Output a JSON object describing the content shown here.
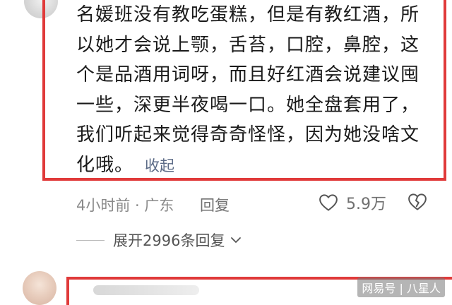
{
  "comment": {
    "lines": [
      "名媛班没有教吃蛋糕，但是有教红酒，所",
      "以她才会说上颚，舌苔，口腔，鼻腔，这",
      "个是品酒用词呀，而且好红酒会说建议囤",
      "一些，深更半夜喝一口。她全盘套用了，",
      "我们听起来觉得奇奇怪怪，因为她没啥文",
      "化哦。"
    ],
    "collapse_label": "收起",
    "time": "4小时前 · 广东",
    "reply_label": "回复",
    "like_count": "5.9万"
  },
  "expand_replies_label": "展开2996条回复",
  "watermark": "网易号 | 八星人",
  "colors": {
    "highlight": "#e03a3a",
    "link": "#5b6a86"
  }
}
